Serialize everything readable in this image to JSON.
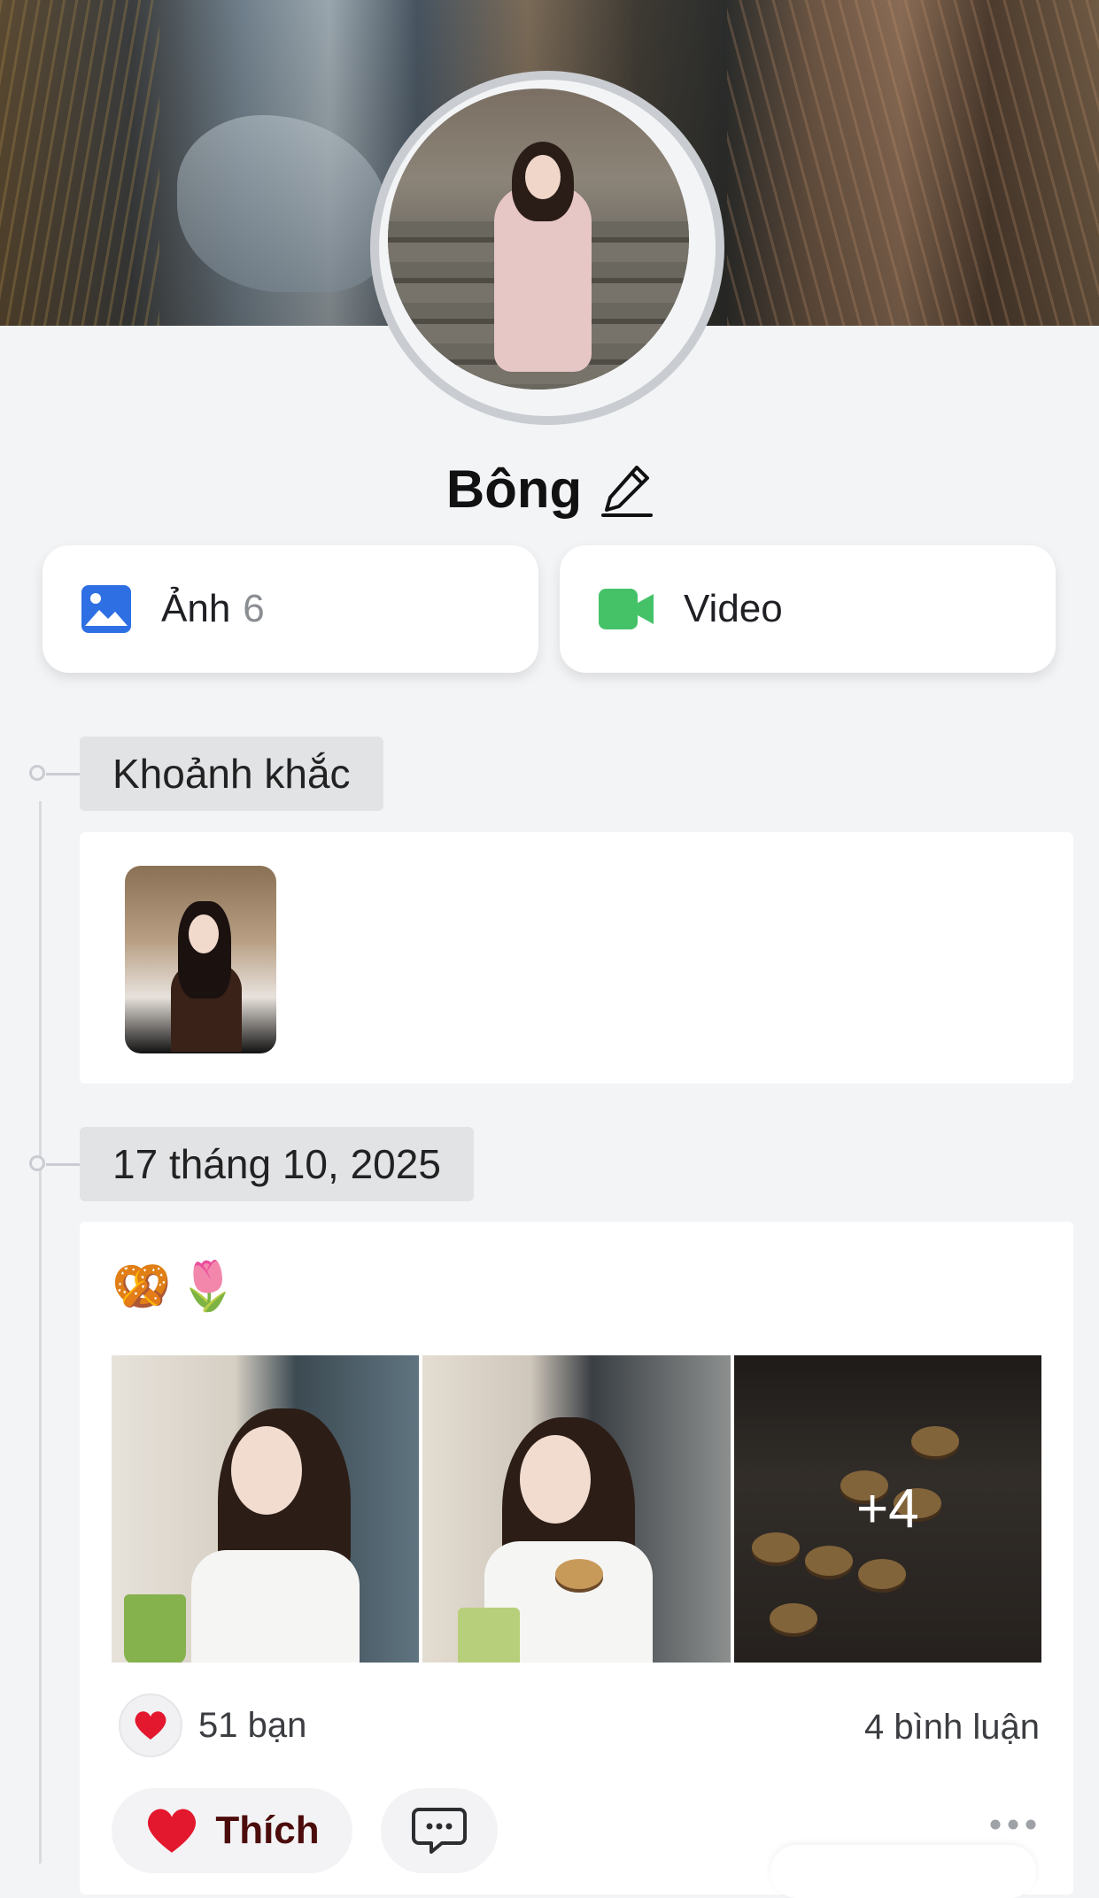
{
  "profile": {
    "name": "Bông"
  },
  "media_tiles": {
    "photos": {
      "label": "Ảnh",
      "count": "6",
      "icon": "photo-icon",
      "color": "#2f6fe4"
    },
    "video": {
      "label": "Video",
      "icon": "video-camera-icon",
      "color": "#45c268"
    }
  },
  "moments": {
    "title": "Khoảnh khắc"
  },
  "post": {
    "date": "17 tháng 10, 2025",
    "text": "🥨🌷",
    "more_photos_label": "+4",
    "reactions_label": "51 bạn",
    "comments_label": "4 bình luận",
    "like_label": "Thích",
    "like_color": "#e3172d"
  }
}
